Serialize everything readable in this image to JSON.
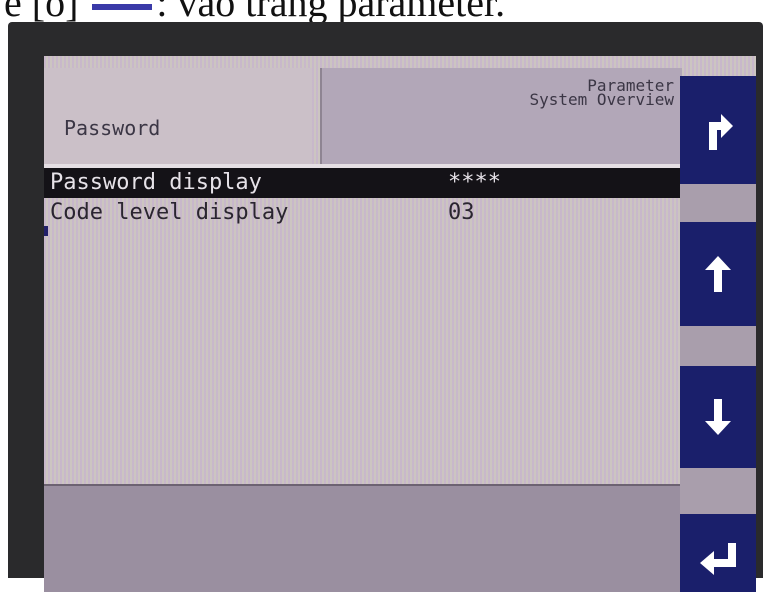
{
  "caption": {
    "prefix": "e [o] ",
    "text": ": vào trang parameter."
  },
  "header": {
    "title": "Password",
    "breadcrumb_line1": "Parameter",
    "breadcrumb_line2": "System Overview"
  },
  "parameters": [
    {
      "label": "Password display",
      "value": "****",
      "selected": true
    },
    {
      "label": "Code level display",
      "value": "03",
      "selected": false
    }
  ],
  "softkeys": [
    {
      "icon": "escape-arrow-icon"
    },
    {
      "icon": "arrow-up-icon"
    },
    {
      "icon": "arrow-down-icon"
    },
    {
      "icon": "enter-icon"
    }
  ],
  "colors": {
    "softkey_bg": "#1a1f6b",
    "selected_row_bg": "#141217",
    "screen_bg": "#cdc4cc"
  }
}
